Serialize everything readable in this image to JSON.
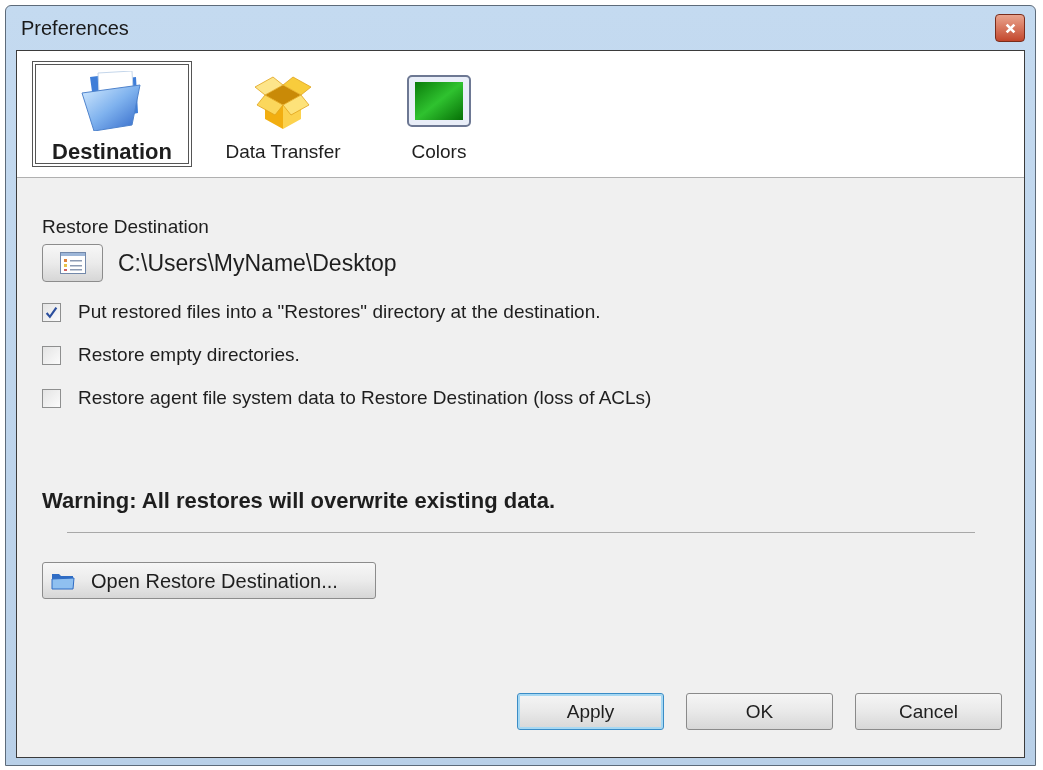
{
  "window": {
    "title": "Preferences"
  },
  "tabs": [
    {
      "label": "Destination",
      "selected": true
    },
    {
      "label": "Data Transfer",
      "selected": false
    },
    {
      "label": "Colors",
      "selected": false
    }
  ],
  "destination": {
    "label": "Restore Destination",
    "path": "C:\\Users\\MyName\\Desktop"
  },
  "options": [
    {
      "label": "Put restored files into a \"Restores\" directory at the destination.",
      "checked": true
    },
    {
      "label": "Restore empty directories.",
      "checked": false
    },
    {
      "label": "Restore agent file system data to Restore Destination (loss of ACLs)",
      "checked": false
    }
  ],
  "warning": "Warning: All restores will overwrite existing data.",
  "open_button": "Open Restore Destination...",
  "buttons": [
    {
      "label": "Apply",
      "focused": true
    },
    {
      "label": "OK",
      "focused": false
    },
    {
      "label": "Cancel",
      "focused": false
    }
  ]
}
